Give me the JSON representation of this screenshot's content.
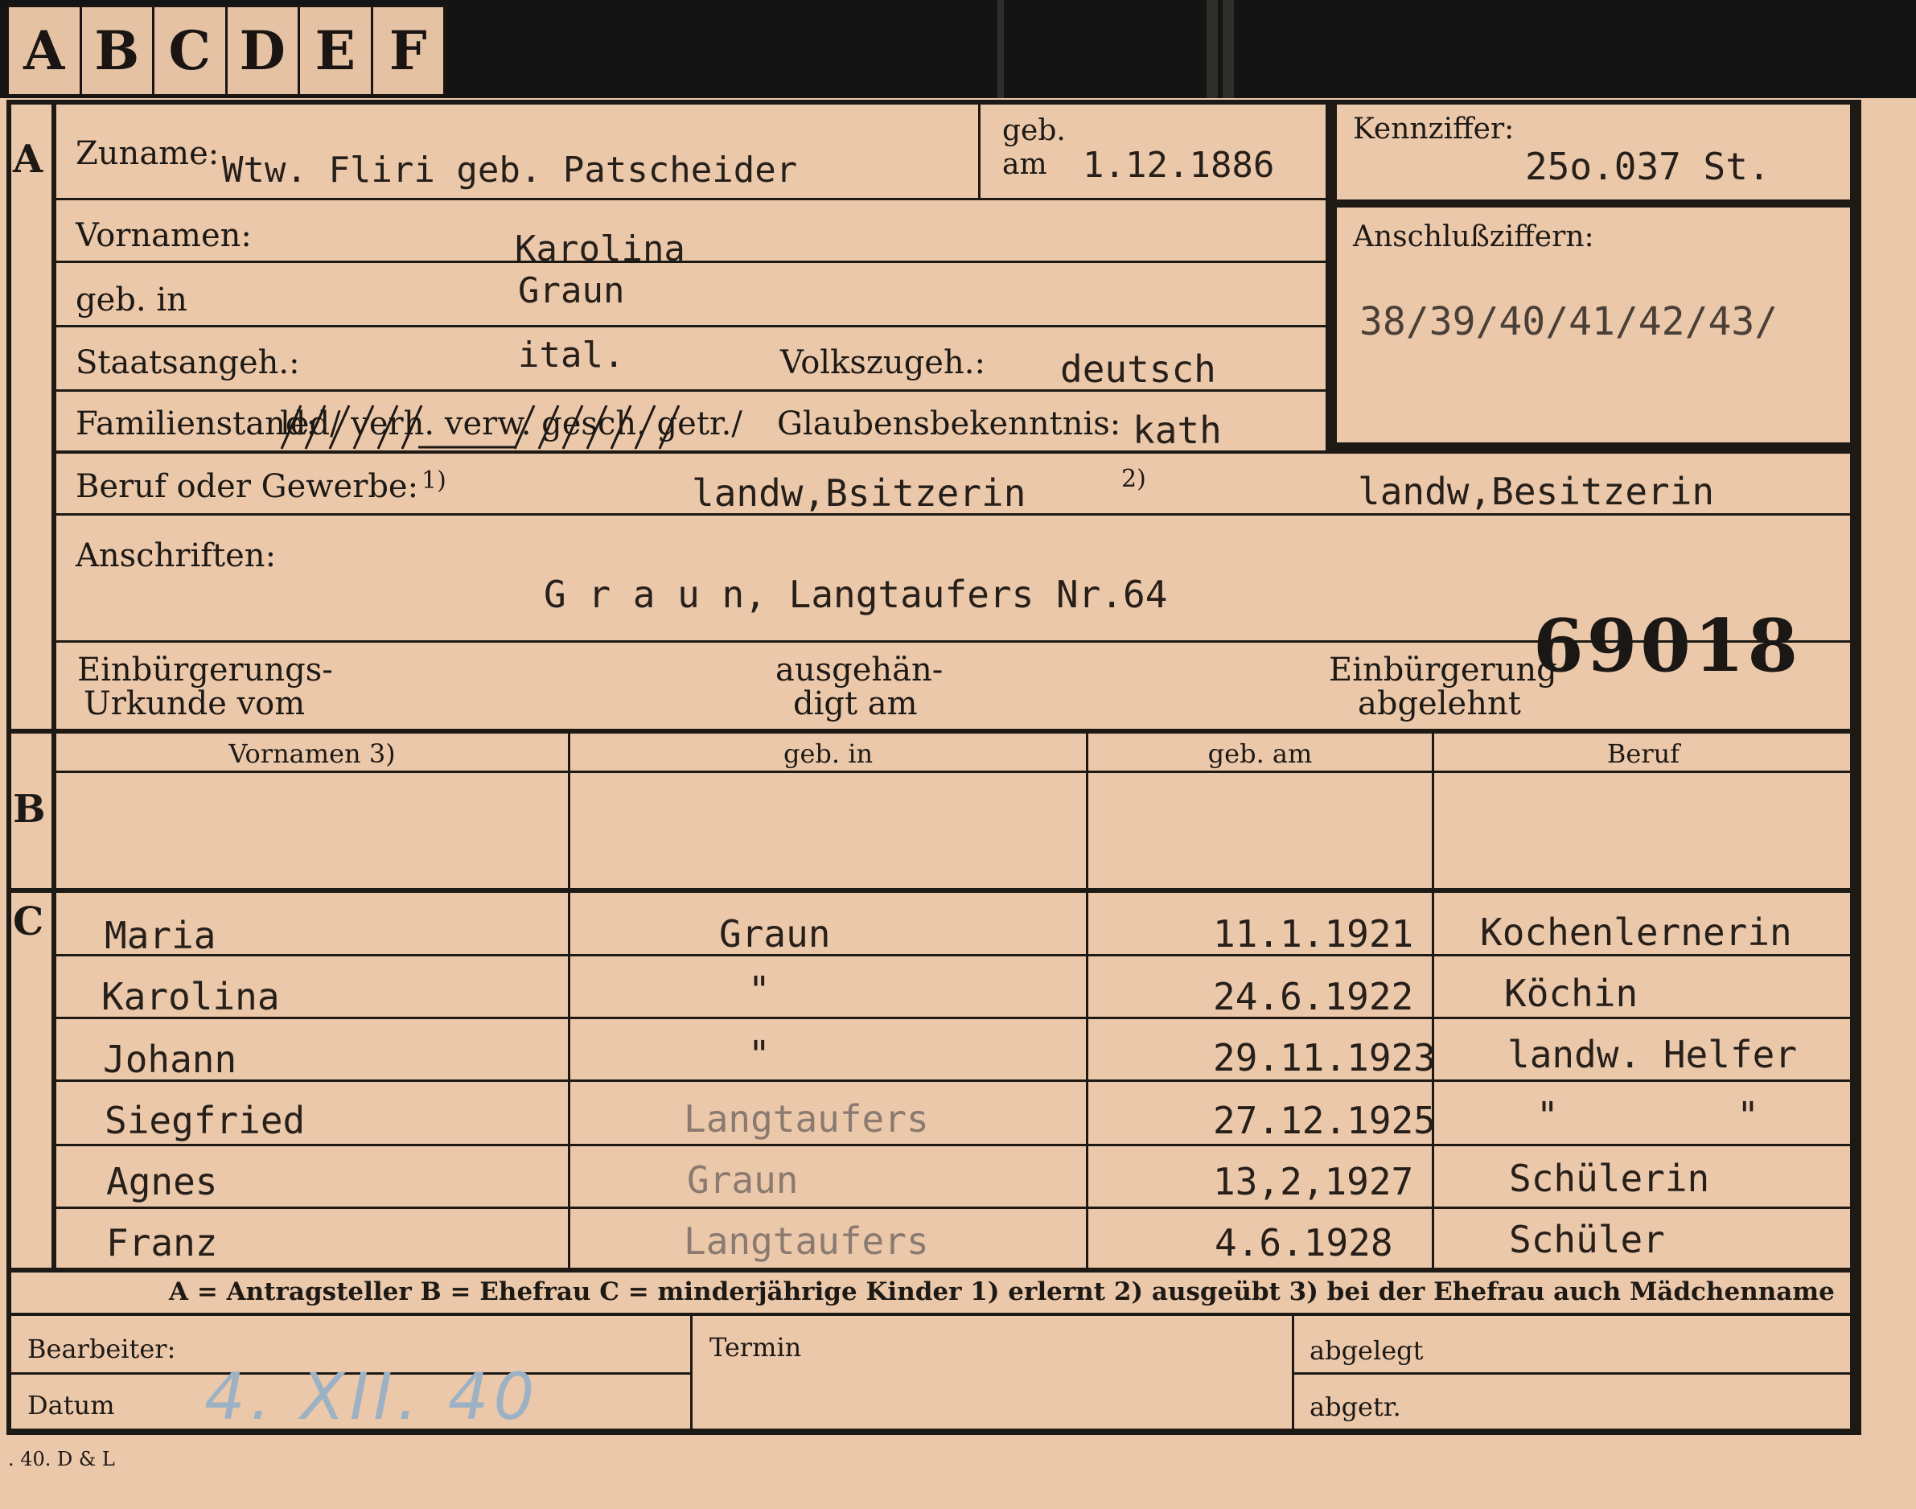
{
  "tabs": [
    "A",
    "B",
    "C",
    "D",
    "E",
    "F"
  ],
  "section_markers": {
    "a": "A",
    "b": "B",
    "c": "C"
  },
  "labels": {
    "zuname": "Zuname:",
    "geb": "geb.",
    "am": "am",
    "kennziffer": "Kennziffer:",
    "vornamen": "Vornamen:",
    "anschlussziffern": "Anschlußziffern:",
    "geb_in": "geb. in",
    "staatsangeh": "Staatsangeh.:",
    "volkszugeh": "Volkszugeh.:",
    "familienstand": "Familienstand:",
    "familienstand_options": "led/ verh. verw. gesch. getr./",
    "glaubensbekenntnis": "Glaubensbekenntnis:",
    "beruf": "Beruf oder Gewerbe:",
    "beruf_note1": "1)",
    "beruf_note2": "2)",
    "anschriften": "Anschriften:",
    "einbuergerungs_urkunde_line1": "Einbürgerungs-",
    "einbuergerungs_urkunde_line2": "Urkunde vom",
    "ausgehaendigt_line1": "ausgehän-",
    "ausgehaendigt_line2": "digt am",
    "einbuergerung_abgelehnt_line1": "Einbürgerung",
    "einbuergerung_abgelehnt_line2": "abgelehnt"
  },
  "applicant": {
    "zuname": "Wtw.   Fliri geb. Patscheider",
    "geb_am": "1.12.1886",
    "kennziffer": "25o.037  St.",
    "vornamen": "Karolina",
    "anschlussziffern": "38/39/40/41/42/43/",
    "geb_in": "Graun",
    "staatsangeh": "ital.",
    "volkszugeh": "deutsch",
    "glaubensbekenntnis": "kath",
    "beruf_erlernt": "landw,Bsitzerin",
    "beruf_ausgeuebt": "landw,Besitzerin",
    "anschrift": "G r a u n, Langtaufers Nr.64",
    "stamp_number": "69018"
  },
  "table_headers": {
    "vornamen": "Vornamen 3)",
    "geb_in": "geb. in",
    "geb_am": "geb. am",
    "beruf": "Beruf"
  },
  "children": [
    {
      "vorname": "Maria",
      "geb_in": "Graun",
      "geb_am": "11.1.1921",
      "beruf": "Kochenlernerin"
    },
    {
      "vorname": "Karolina",
      "geb_in": "\"",
      "geb_am": "24.6.1922",
      "beruf": "Köchin"
    },
    {
      "vorname": "Johann",
      "geb_in": "\"",
      "geb_am": "29.11.1923",
      "beruf": "landw. Helfer"
    },
    {
      "vorname": "Siegfried",
      "geb_in": "Langtaufers",
      "geb_am": "27.12.1925",
      "beruf": "\"        \""
    },
    {
      "vorname": "Agnes",
      "geb_in": "Graun",
      "geb_am": "13,2,1927",
      "beruf": "Schülerin"
    },
    {
      "vorname": "Franz",
      "geb_in": "Langtaufers",
      "geb_am": "4.6.1928",
      "beruf": "Schüler"
    }
  ],
  "legend": "A = Antragsteller   B = Ehefrau   C = minderjährige Kinder   1) erlernt   2) ausgeübt   3) bei der Ehefrau auch Mädchenname",
  "footer": {
    "bearbeiter": "Bearbeiter:",
    "datum": "Datum",
    "datum_value": "4. XII. 40",
    "termin": "Termin",
    "abgelegt": "abgelegt",
    "abgetr": "abgetr."
  },
  "printer_mark": ". 40. D & L"
}
